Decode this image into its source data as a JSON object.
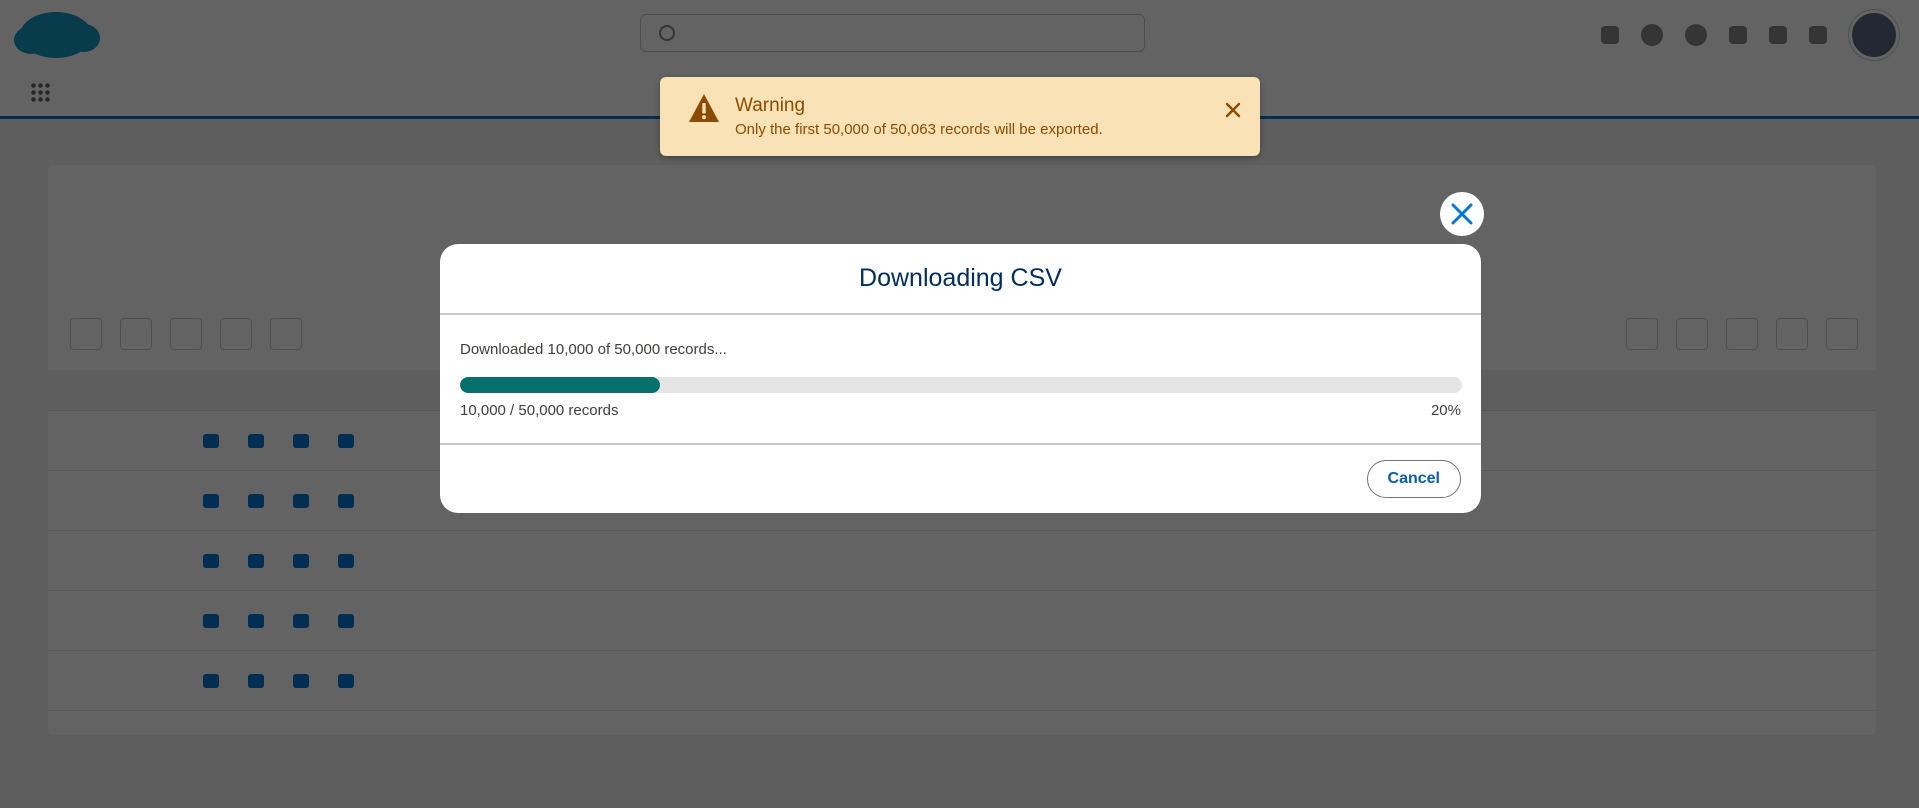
{
  "toast": {
    "title": "Warning",
    "message": "Only the first 50,000 of 50,063 records will be exported.",
    "icon": "warning-icon",
    "background": "#f9e2b6",
    "text_color": "#8c4b02"
  },
  "modal": {
    "title": "Downloading CSV",
    "progress_label": "Downloaded 10,000 of 50,000 records...",
    "progress_fraction": 0.2,
    "progress_count": "10,000 / 50,000 records",
    "progress_percent": "20%",
    "cancel_label": "Cancel",
    "accent": "#06706d",
    "title_color": "#032d60"
  }
}
